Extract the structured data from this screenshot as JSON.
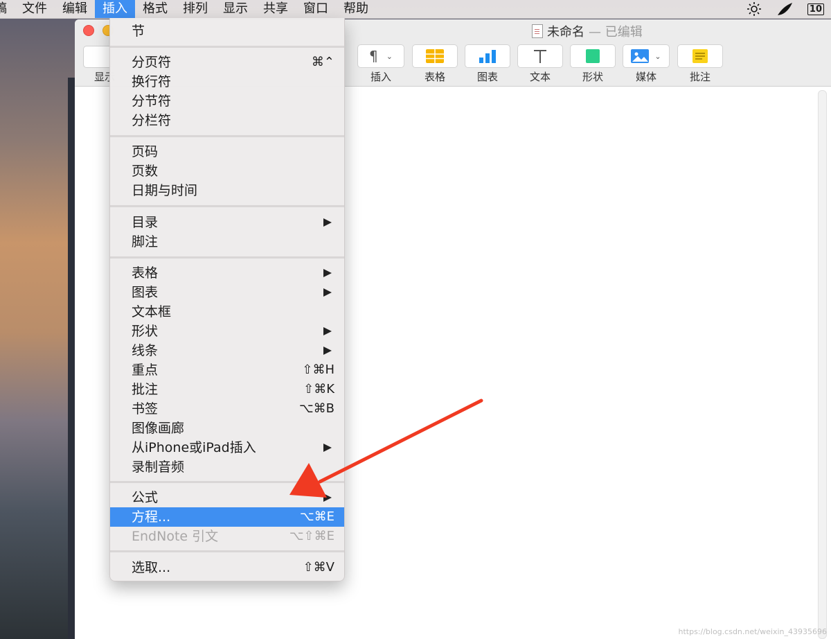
{
  "menubar": {
    "items": [
      "稿",
      "文件",
      "编辑",
      "插入",
      "格式",
      "排列",
      "显示",
      "共享",
      "窗口",
      "帮助"
    ],
    "active_index": 3,
    "badge": "10"
  },
  "window": {
    "title": "未命名",
    "edited": "— 已编辑",
    "left_tool_label": "显示"
  },
  "toolbar": [
    {
      "label": "插入",
      "icon": "paragraph-icon"
    },
    {
      "label": "表格",
      "icon": "table-icon"
    },
    {
      "label": "图表",
      "icon": "chart-icon"
    },
    {
      "label": "文本",
      "icon": "text-icon"
    },
    {
      "label": "形状",
      "icon": "shape-icon"
    },
    {
      "label": "媒体",
      "icon": "media-icon"
    },
    {
      "label": "批注",
      "icon": "comment-icon"
    }
  ],
  "menu": {
    "items": [
      {
        "label": "节"
      },
      {
        "label": "分页符",
        "shortcut": "⌘⌃"
      },
      {
        "label": "换行符"
      },
      {
        "label": "分节符"
      },
      {
        "label": "分栏符"
      },
      {
        "label": "页码"
      },
      {
        "label": "页数"
      },
      {
        "label": "日期与时间"
      },
      {
        "label": "目录",
        "submenu": true
      },
      {
        "label": "脚注"
      },
      {
        "label": "表格",
        "submenu": true
      },
      {
        "label": "图表",
        "submenu": true
      },
      {
        "label": "文本框"
      },
      {
        "label": "形状",
        "submenu": true
      },
      {
        "label": "线条",
        "submenu": true
      },
      {
        "label": "重点",
        "shortcut": "⇧⌘H"
      },
      {
        "label": "批注",
        "shortcut": "⇧⌘K"
      },
      {
        "label": "书签",
        "shortcut": "⌥⌘B"
      },
      {
        "label": "图像画廊"
      },
      {
        "label": "从iPhone或iPad插入",
        "submenu": true
      },
      {
        "label": "录制音频"
      },
      {
        "label": "公式",
        "submenu": true
      },
      {
        "label": "方程...",
        "shortcut": "⌥⌘E",
        "highlighted": true
      },
      {
        "label": "EndNote 引文",
        "shortcut": "⌥⇧⌘E",
        "disabled": true
      },
      {
        "label": "选取...",
        "shortcut": "⇧⌘V"
      }
    ]
  },
  "watermark": "https://blog.csdn.net/weixin_43935696",
  "colors": {
    "highlight": "#3f8ff1",
    "annotation_arrow": "#f03a22"
  }
}
